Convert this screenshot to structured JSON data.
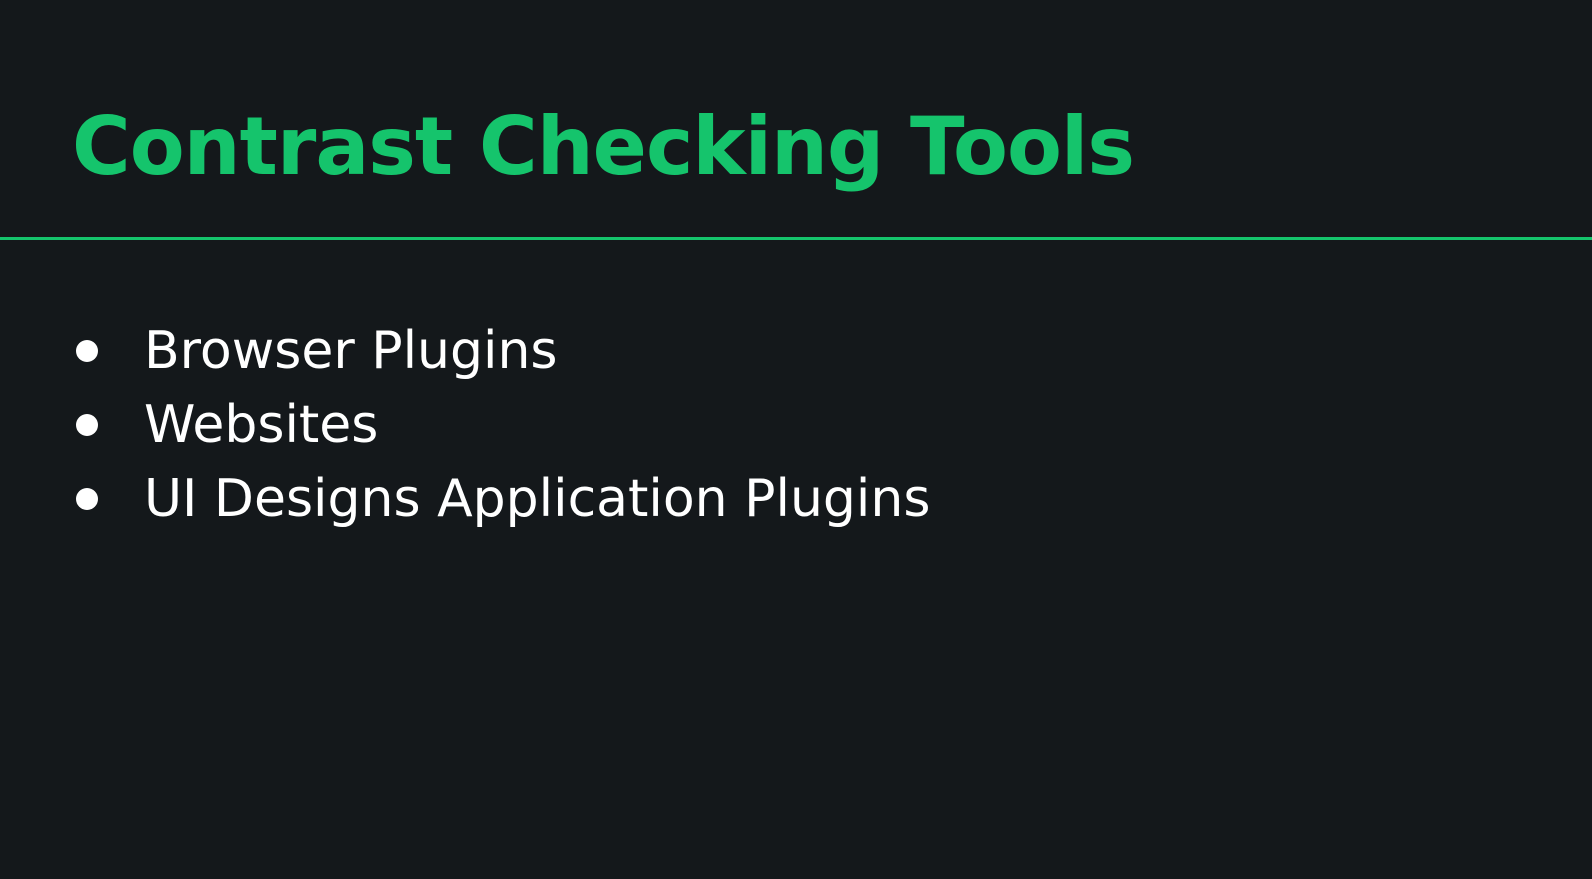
{
  "slide": {
    "title": "Contrast Checking Tools",
    "bullets": [
      {
        "text": "Browser Plugins"
      },
      {
        "text": "Websites"
      },
      {
        "text": "UI Designs Application Plugins"
      }
    ]
  },
  "colors": {
    "background": "#14181b",
    "accent": "#15c46c",
    "text": "#ffffff"
  }
}
